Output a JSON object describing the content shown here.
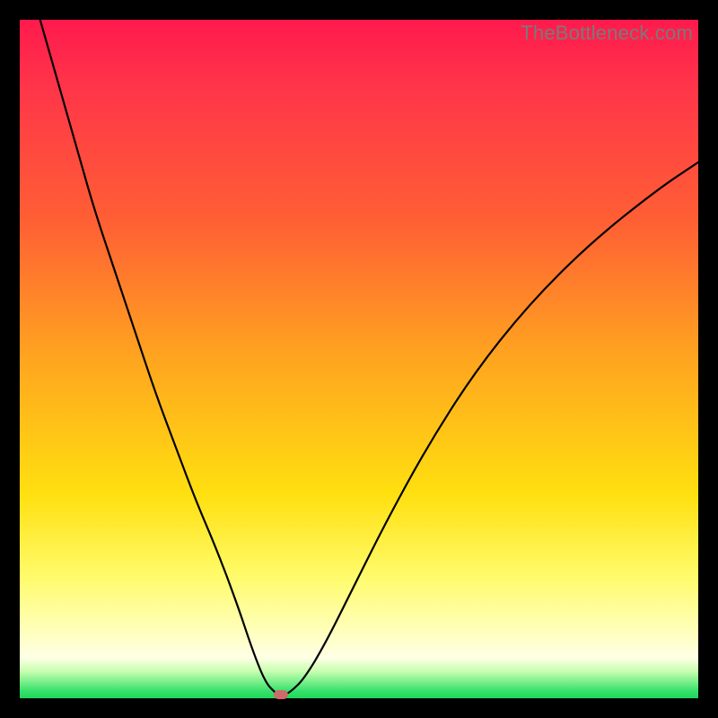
{
  "watermark": "TheBottleneck.com",
  "chart_data": {
    "type": "line",
    "title": "",
    "xlabel": "",
    "ylabel": "",
    "xlim": [
      0,
      100
    ],
    "ylim": [
      0,
      100
    ],
    "grid": false,
    "legend": false,
    "description": "Bottleneck percentage curve over rainbow gradient. Vertical axis ≈ bottleneck severity (top=high/red, bottom=none/green). Horizontal axis is an implicit component-balance axis. Curve dips to ~0 at the optimum point then rises again.",
    "series": [
      {
        "name": "bottleneck-curve",
        "color": "#000000",
        "x": [
          3,
          5,
          7,
          9,
          11,
          14,
          17,
          20,
          23,
          26,
          29,
          32,
          34,
          35.5,
          36.5,
          37.5,
          38,
          39,
          40,
          42,
          45,
          49,
          54,
          60,
          67,
          75,
          84,
          94,
          100
        ],
        "y": [
          100,
          93,
          86,
          79,
          72,
          63,
          54,
          45,
          37,
          29,
          22,
          14,
          8,
          4,
          2,
          1,
          0.5,
          0.5,
          1,
          3,
          8,
          16,
          26,
          37,
          48,
          58,
          67,
          75,
          79
        ]
      }
    ],
    "marker": {
      "x": 38.5,
      "y": 0.5,
      "color": "#cf6a6a"
    },
    "background_gradient": {
      "type": "linear-vertical",
      "stops": [
        {
          "pos": 0,
          "color": "#ff1a4d"
        },
        {
          "pos": 30,
          "color": "#ff6034"
        },
        {
          "pos": 50,
          "color": "#ffa51f"
        },
        {
          "pos": 70,
          "color": "#ffe010"
        },
        {
          "pos": 90,
          "color": "#ffffba"
        },
        {
          "pos": 99,
          "color": "#34e06a"
        },
        {
          "pos": 100,
          "color": "#1fd85a"
        }
      ]
    }
  }
}
